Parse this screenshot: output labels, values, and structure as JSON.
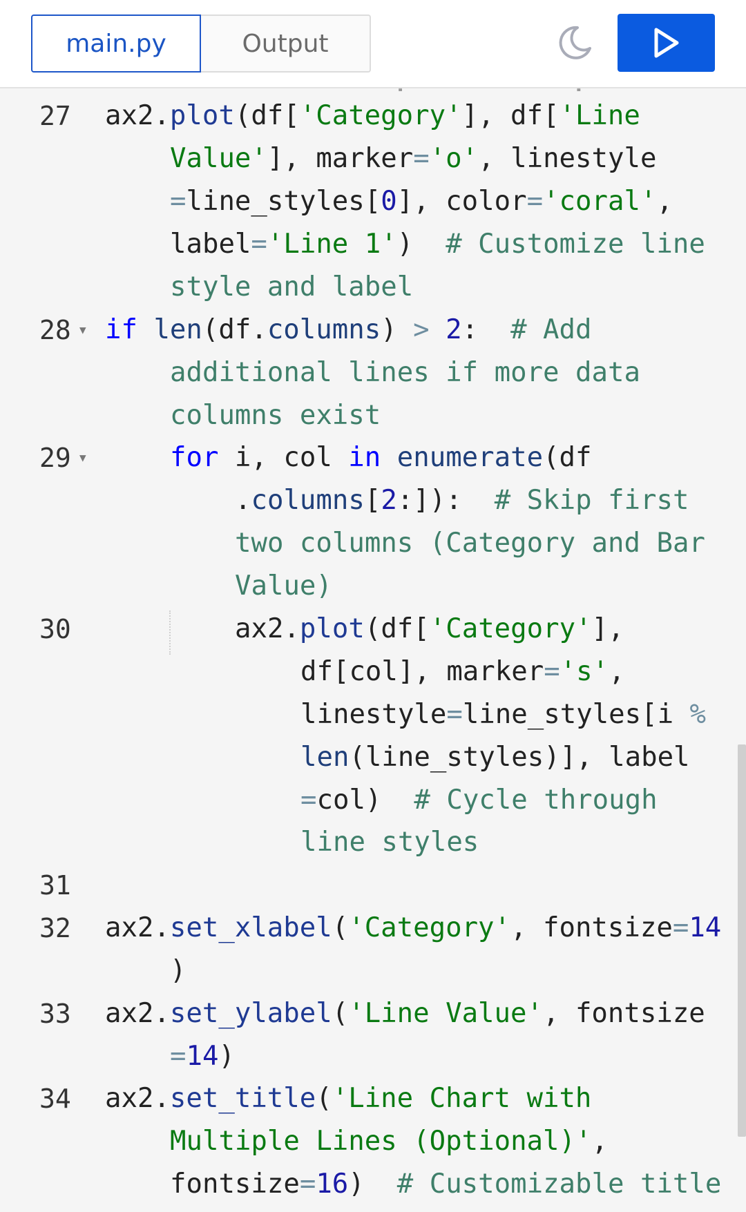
{
  "tabs": [
    {
      "label": "main.py",
      "active": true
    },
    {
      "label": "Output",
      "active": false
    }
  ],
  "icons": {
    "theme": "moon-icon",
    "run": "play-icon"
  },
  "colors": {
    "accent": "#0b5be0",
    "tab_active_border": "#1d56c9"
  },
  "ghost_line": "        .          .",
  "line_numbers": [
    "27",
    "28",
    "29",
    "30",
    "31",
    "32",
    "33",
    "34"
  ],
  "code": {
    "l27": {
      "a": "ax2.",
      "b": "plot",
      "c": "(df[",
      "d": "'Category'",
      "e": "], df[",
      "f": "'Line",
      "g": "Value'",
      "h": "], marker",
      "i": "=",
      "j": "'o'",
      "k": ", linestyle",
      "l": "=",
      "m": "line_styles[",
      "n": "0",
      "o": "], color",
      "p": "=",
      "q": "'coral'",
      "r": ",",
      "s": "label",
      "t": "=",
      "u": "'Line 1'",
      "v": ")  ",
      "w": "# Customize line",
      "x": "style and label"
    },
    "l28": {
      "a": "if",
      "b": "len",
      "c": "(df.",
      "d": "columns",
      "e": ") ",
      "f": ">",
      "g": " ",
      "h": "2",
      "i": ":  ",
      "j": "# Add",
      "k": "additional lines if more data",
      "l": "columns exist"
    },
    "l29": {
      "a": "for",
      "b": " i, col ",
      "c": "in",
      "d": " ",
      "e": "enumerate",
      "f": "(df",
      "g": ".",
      "h": "columns",
      "i": "[",
      "j": "2",
      "k": ":]):  ",
      "l": "# Skip first",
      "m": "two columns (Category and Bar",
      "n": "Value)"
    },
    "l30": {
      "a": "ax2.",
      "b": "plot",
      "c": "(df[",
      "d": "'Category'",
      "e": "],",
      "f": "df[col], marker",
      "g": "=",
      "h": "'s'",
      "i": ",",
      "j": "linestyle",
      "k": "=",
      "l": "line_styles[i ",
      "m": "%",
      "n": "len",
      "o": "(line_styles)], label",
      "p": "=",
      "q": "col)  ",
      "r": "# Cycle through",
      "s": "line styles"
    },
    "l32": {
      "a": "ax2.",
      "b": "set_xlabel",
      "c": "(",
      "d": "'Category'",
      "e": ", fontsize",
      "f": "=",
      "g": "14",
      "h": ")"
    },
    "l33": {
      "a": "ax2.",
      "b": "set_ylabel",
      "c": "(",
      "d": "'Line Value'",
      "e": ", fontsize",
      "f": "=",
      "g": "14",
      "h": ")"
    },
    "l34": {
      "a": "ax2.",
      "b": "set_title",
      "c": "(",
      "d": "'Line Chart with",
      "e": "Multiple Lines (Optional)'",
      "f": ",",
      "g": "fontsize",
      "h": "=",
      "i": "16",
      "j": ")  ",
      "k": "# Customizable title"
    }
  }
}
